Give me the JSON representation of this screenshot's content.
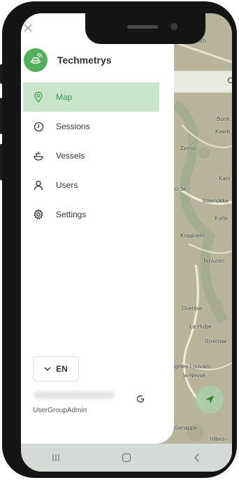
{
  "app": {
    "brand_name": "Techmetrys",
    "brand_color": "#55b05e",
    "accent_color": "#3e9a48",
    "active_bg": "#c9e6cc"
  },
  "drawer": {
    "close_icon": "close-icon",
    "nav_items": [
      {
        "label": "Map",
        "icon": "map-pin-icon",
        "active": true
      },
      {
        "label": "Sessions",
        "icon": "clock-icon",
        "active": false
      },
      {
        "label": "Vessels",
        "icon": "vessel-icon",
        "active": false
      },
      {
        "label": "Users",
        "icon": "user-icon",
        "active": false
      },
      {
        "label": "Settings",
        "icon": "gear-icon",
        "active": false
      }
    ],
    "language": {
      "label": "EN",
      "icon": "chevron-down-icon"
    },
    "user": {
      "role": "UserGroupAdmin",
      "logout_icon": "logout-icon"
    }
  },
  "map": {
    "search_icon": "search-icon",
    "locate_icon": "navigation-arrow-icon",
    "labels": [
      "ontich",
      "Bonh",
      "Keerb",
      "Zemst",
      "Kam",
      "orde",
      "Steenokke",
      "Korte",
      "Kraainem",
      "Tervuren",
      "Overijse",
      "La Hulpe",
      "Rixensar",
      "tignies-Louvain-",
      "la-Neuve",
      "Genappe",
      "Villers-"
    ]
  },
  "system_nav": {
    "recents_icon": "recents-icon",
    "home_icon": "home-icon",
    "back_icon": "back-icon"
  }
}
